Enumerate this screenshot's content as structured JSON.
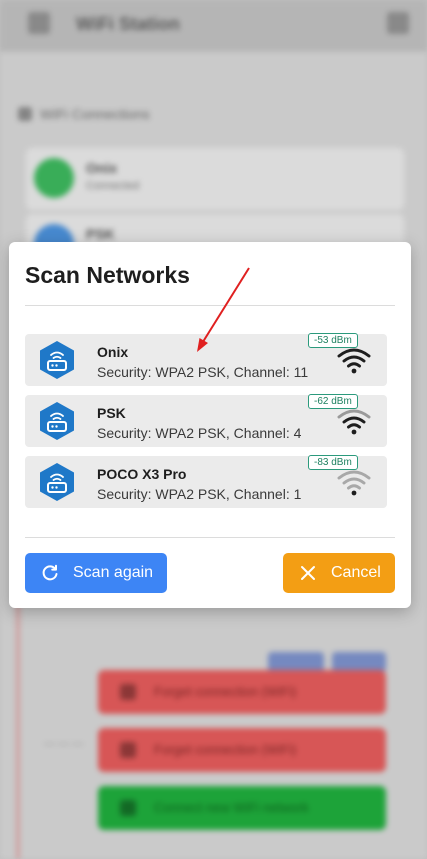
{
  "background": {
    "title": "WiFi Station",
    "section_label": "WiFi Connections",
    "cards": [
      {
        "name": "Onix",
        "sub": "Connected",
        "color": "#3cb55c"
      },
      {
        "name": "PSK",
        "sub": "",
        "color": "#4a8fd8"
      }
    ],
    "buttons": [
      {
        "label": "Forget connection (WiFi)",
        "color": "#e05a5a"
      },
      {
        "label": "Forget connection (WiFi)",
        "color": "#e05a5a"
      },
      {
        "label": "Connect new WiFi network",
        "color": "#1faa3c"
      }
    ]
  },
  "modal": {
    "title": "Scan Networks",
    "networks": [
      {
        "name": "Onix",
        "detail": "Security: WPA2 PSK, Channel: 11",
        "signal": "-53 dBm",
        "strength": 4,
        "icon": "router-icon"
      },
      {
        "name": "PSK",
        "detail": "Security: WPA2 PSK, Channel: 4",
        "signal": "-62 dBm",
        "strength": 3,
        "icon": "router-icon"
      },
      {
        "name": "POCO X3 Pro",
        "detail": "Security: WPA2 PSK, Channel: 1",
        "signal": "-83 dBm",
        "strength": 1,
        "icon": "router-icon"
      }
    ],
    "scan_again_label": "Scan again",
    "cancel_label": "Cancel"
  },
  "colors": {
    "accent_blue": "#3d85f5",
    "accent_orange": "#f39e14",
    "badge_green": "#2b9a7c",
    "router_blue": "#1f78c8",
    "annotation_red": "#e02020"
  }
}
